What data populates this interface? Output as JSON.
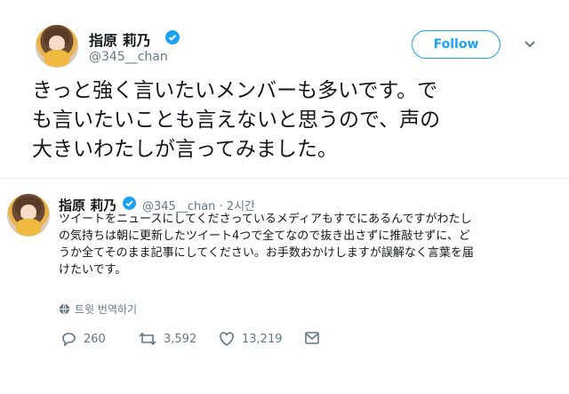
{
  "tweet": {
    "author_name": "指原 莉乃",
    "handle": "@345__chan",
    "follow_label": "Follow",
    "text_lines": [
      "きっと強く言いたいメンバーも多いです。で",
      "も言いたいことも言えないと思うので、声の",
      "大きいわたしが言ってみました。"
    ]
  },
  "quoted": {
    "author_name": "指原 莉乃",
    "handle_time": "@345__chan · 2시간",
    "text_lines": [
      "ツイートをニュースにしてくださっているメディアもすでにあるんですがわたし",
      "の気持ちは朝に更新したツイート4つで全てなので抜き出さずに推敲せずに、ど",
      "うか全てそのまま記事にしてください。お手数おかけしますが誤解なく言葉を届",
      "けたいです。"
    ],
    "translate_label": "트윗 번역하기",
    "replies": "260",
    "retweets": "3,592",
    "likes": "13,219"
  },
  "colors": {
    "accent": "#1da1f2",
    "muted": "#657786",
    "text": "#14171a"
  },
  "icons": [
    "verified-badge-icon",
    "chevron-down-icon",
    "globe-icon",
    "reply-icon",
    "retweet-icon",
    "like-icon",
    "message-icon"
  ]
}
